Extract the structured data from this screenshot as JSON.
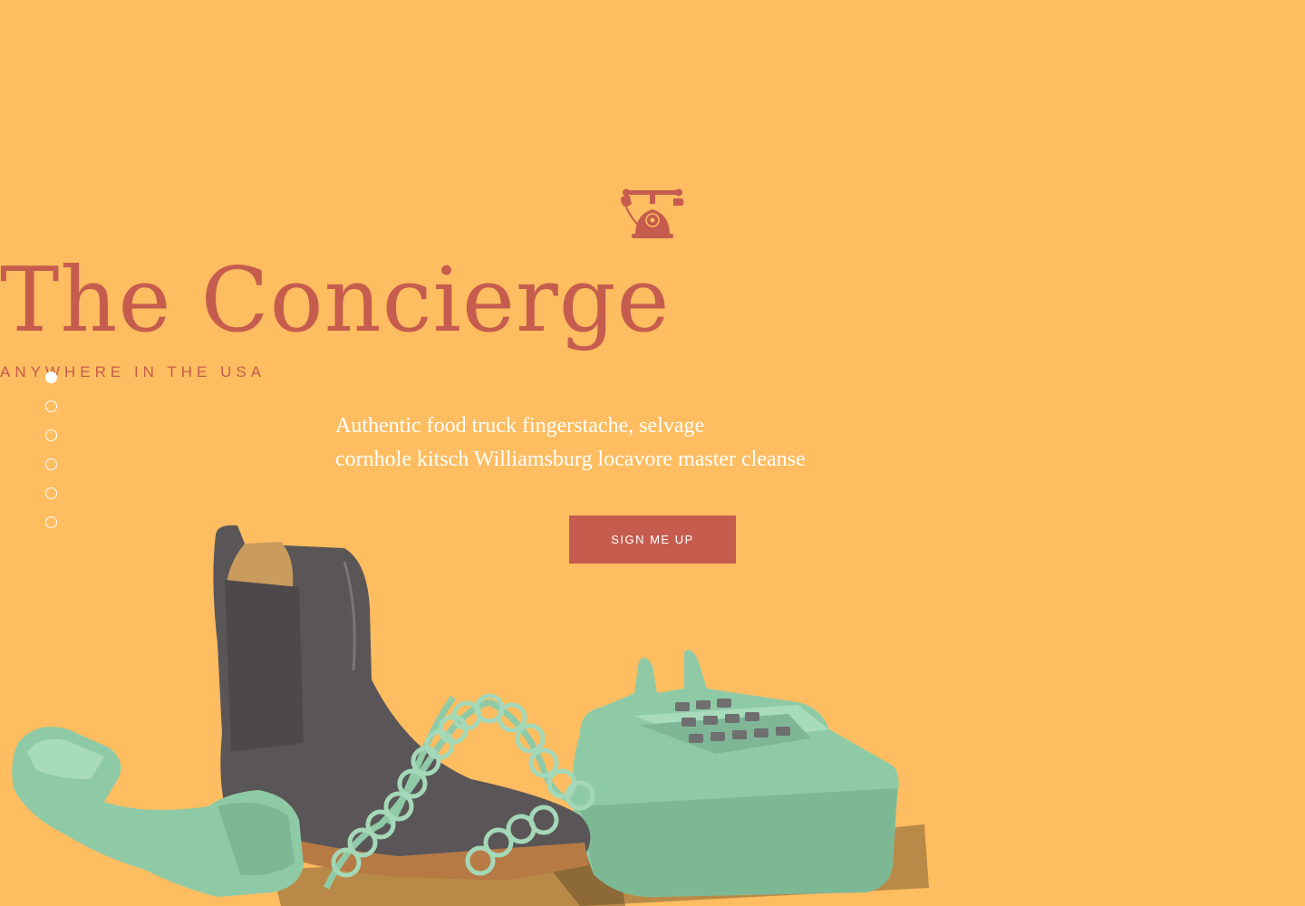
{
  "hero": {
    "title": "The Concierge",
    "subtitle": "ANYWHERE IN THE USA",
    "description_lines": [
      "Authentic food truck fingerstache, selvage",
      "cornhole kitsch Williamsburg locavore master cleanse"
    ],
    "cta_label": "SIGN ME UP",
    "logo_icon": "rotary-telephone-icon"
  },
  "slider": {
    "total": 6,
    "active_index": 0
  },
  "colors": {
    "background": "#fdbd60",
    "accent": "#c65c4e",
    "text_light": "#ffffff",
    "phone_green": "#8fcaa6",
    "boot_grey": "#5a5658"
  }
}
